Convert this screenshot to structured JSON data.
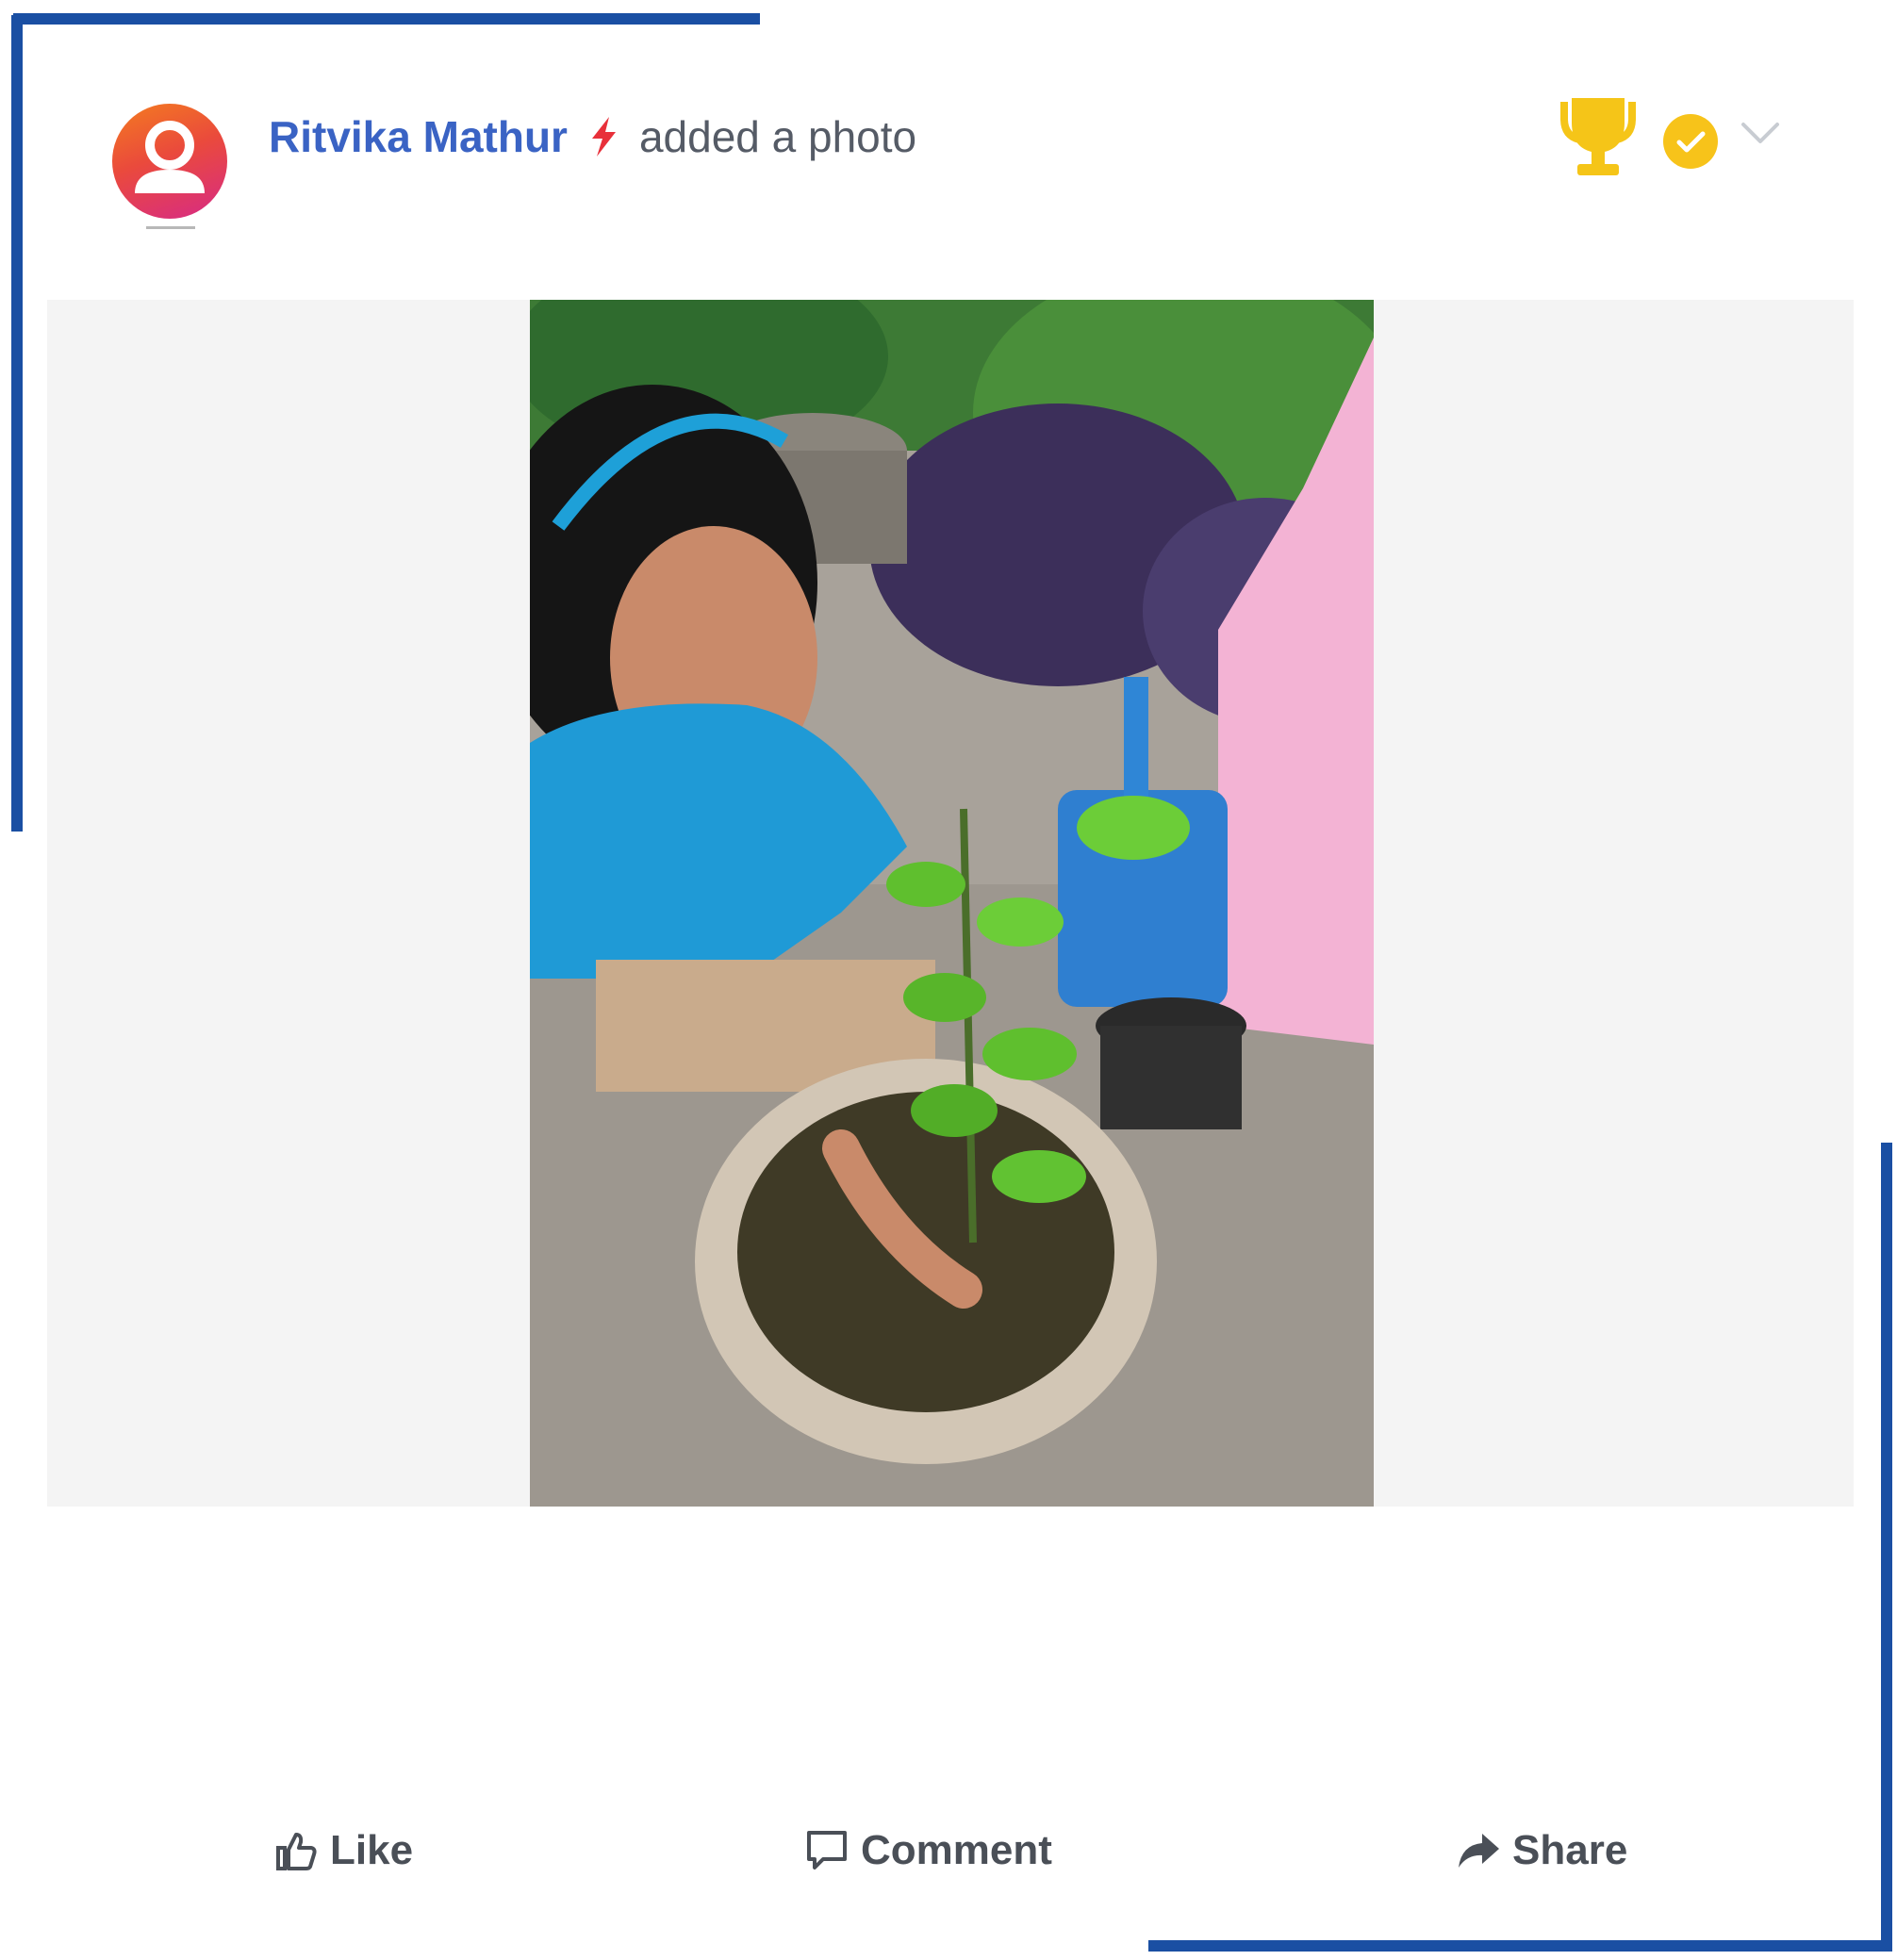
{
  "post": {
    "author_name": "Ritvika Mathur",
    "action_text": "added a photo",
    "icons": {
      "avatar": "user-avatar-icon",
      "badge": "lightning-bolt-icon",
      "award": "trophy-icon",
      "status": "verified-check-icon",
      "menu": "chevron-down-icon"
    },
    "photo_description_icon": "photo-girl-planting-sapling"
  },
  "actions": {
    "like_label": "Like",
    "comment_label": "Comment",
    "share_label": "Share"
  },
  "colors": {
    "frame": "#1a4fa3",
    "author": "#3a63c4",
    "bolt": "#e8303a",
    "trophy": "#f5c518",
    "verified": "#f7c31a",
    "media_bg": "#f4f4f4"
  }
}
